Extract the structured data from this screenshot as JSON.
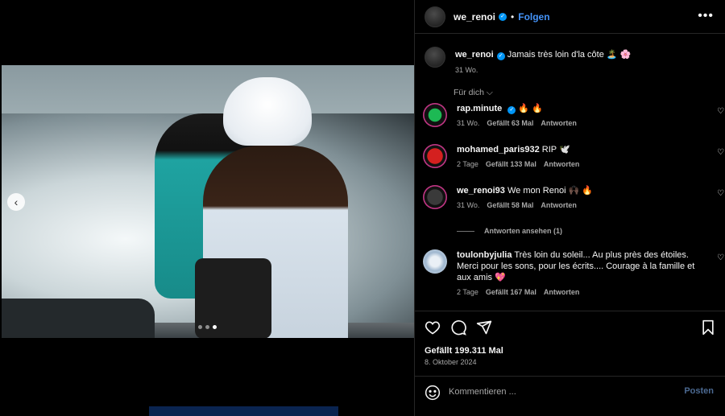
{
  "post": {
    "username": "we_renoi",
    "follow_label": "Folgen",
    "separator": "•",
    "more_icon": "more-horizontal-icon",
    "caption_text": "Jamais très loin d'la côte 🏝️ 🌸",
    "caption_age": "31 Wo.",
    "sort_label": "Für dich ⌵",
    "carousel_prev_icon": "chevron-left-icon",
    "carousel_dots": 3,
    "carousel_active_index": 2
  },
  "comments": [
    {
      "user": "rap.minute",
      "verified": true,
      "text": "🔥 🔥",
      "age": "31 Wo.",
      "likes": "Gefällt 63 Mal",
      "reply": "Antworten",
      "avatar_color": "#1db954"
    },
    {
      "user": "mohamed_paris932",
      "verified": false,
      "text": "RIP 🕊️",
      "age": "2 Tage",
      "likes": "Gefällt 133 Mal",
      "reply": "Antworten",
      "avatar_color": "#d4201f"
    },
    {
      "user": "we_renoi93",
      "verified": false,
      "text": "We mon Renoi 🙌🏿 🔥",
      "age": "31 Wo.",
      "likes": "Gefällt 58 Mal",
      "reply": "Antworten",
      "avatar_color": "#2a2a2a"
    },
    {
      "user": "toulonbyjulia",
      "verified": false,
      "text": "Très loin du soleil... Au plus près des étoiles. Merci pour les sons, pour les écrits.... Courage à la famille et aux amis 💖",
      "age": "2 Tage",
      "likes": "Gefällt 167 Mal",
      "reply": "Antworten",
      "avatar_color": "#d8e4f0"
    }
  ],
  "view_replies": "Antworten ansehen (1)",
  "actions": {
    "like_icon": "heart-icon",
    "comment_icon": "comment-icon",
    "share_icon": "share-icon",
    "save_icon": "bookmark-icon",
    "likes_text": "Gefällt 199.311 Mal",
    "date_text": "8. Oktober 2024"
  },
  "composer": {
    "emoji_icon": "emoji-icon",
    "placeholder": "Kommentieren ...",
    "post_label": "Posten"
  },
  "colors": {
    "accent": "#4493f8",
    "verified": "#0095f6",
    "muted": "#a8a8a8",
    "background": "#000000"
  }
}
